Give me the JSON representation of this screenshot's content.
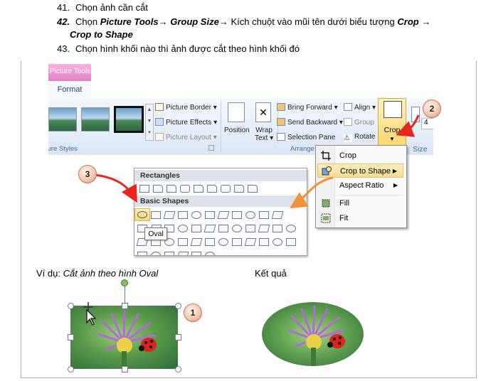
{
  "steps": [
    {
      "num": "41.",
      "text": "Chọn ảnh cần cắt"
    },
    {
      "num": "42.",
      "prefix": "Chọn ",
      "path_a": "Picture Tools",
      "arrow1": "→ ",
      "path_b": "Group Size",
      "arrow2": "→ ",
      "middle": "Kích chuột vào mũi tên dưới biểu tượng ",
      "crop": "Crop",
      "arrow3": " →",
      "line2": "Crop to Shape"
    },
    {
      "num": "43.",
      "text": "Chọn hình khối nào thì ảnh được cắt theo hình khối đó"
    }
  ],
  "ribbon": {
    "context_tab": "Picture Tools",
    "format_tab": "Format",
    "styles_group": "ture Styles",
    "picture_border": "Picture Border",
    "picture_effects": "Picture Effects",
    "picture_layout": "Picture Layout",
    "position": "Position",
    "wrap_text_1": "Wrap",
    "wrap_text_2": "Text",
    "bring_forward": "Bring Forward",
    "send_backward": "Send Backward",
    "selection_pane": "Selection Pane",
    "align": "Align",
    "group": "Group",
    "rotate": "Rotate",
    "arrange_group": "Arrange",
    "crop": "Crop",
    "size_group": "Size",
    "size_value": "4"
  },
  "crop_menu": [
    {
      "label": "Crop",
      "icon": "crop-icon"
    },
    {
      "label": "Crop to Shape",
      "icon": "crop-to-shape-icon",
      "submenu": true,
      "highlighted": true
    },
    {
      "label": "Aspect Ratio",
      "submenu": true
    },
    {
      "label": "Fill",
      "icon": "fill-icon"
    },
    {
      "label": "Fit",
      "icon": "fit-icon"
    }
  ],
  "gallery": {
    "rectangles_header": "Rectangles",
    "basic_shapes_header": "Basic Shapes",
    "tooltip": "Oval"
  },
  "badges": {
    "one": "1",
    "two": "2",
    "three": "3"
  },
  "example_caption_prefix": "Ví dụ: ",
  "example_caption_italic": "Cắt ảnh theo hình Oval",
  "result_caption": "Kết quả",
  "colors": {
    "accent_arrow": "#e8251f",
    "orange_arrow": "#f0923a",
    "ribbon_blue": "#dfe8f5",
    "highlight": "#f8dc8e",
    "context_pink": "#e57fc4"
  }
}
